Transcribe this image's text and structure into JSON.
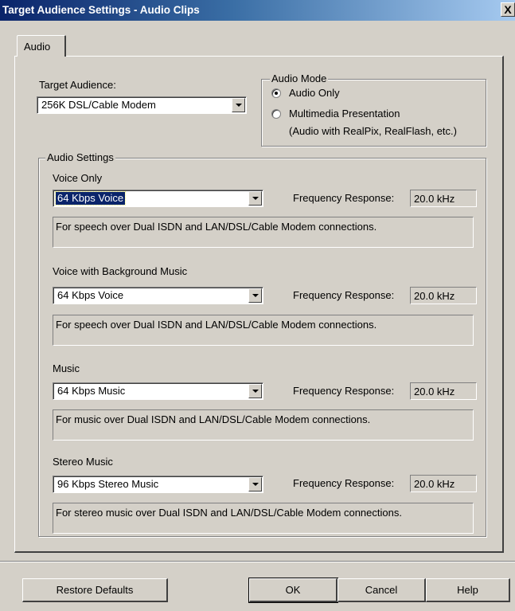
{
  "window": {
    "title": "Target Audience Settings - Audio Clips",
    "close_glyph": "X"
  },
  "tabs": [
    {
      "label": "Audio",
      "active": true
    }
  ],
  "target_audience": {
    "label": "Target Audience:",
    "value": "256K DSL/Cable Modem"
  },
  "audio_mode": {
    "label": "Audio Mode",
    "options": [
      {
        "label": "Audio Only",
        "selected": true
      },
      {
        "label": "Multimedia Presentation",
        "sublabel": "(Audio with RealPix, RealFlash, etc.)",
        "selected": false
      }
    ]
  },
  "audio_settings": {
    "label": "Audio Settings",
    "sections": [
      {
        "label": "Voice Only",
        "value": "64 Kbps Voice",
        "freq_label": "Frequency Response:",
        "freq_value": "20.0 kHz",
        "description": "For speech over Dual ISDN and LAN/DSL/Cable Modem connections."
      },
      {
        "label": "Voice with Background Music",
        "value": "64 Kbps Voice",
        "freq_label": "Frequency Response:",
        "freq_value": "20.0 kHz",
        "description": "For speech over Dual ISDN and LAN/DSL/Cable Modem connections."
      },
      {
        "label": "Music",
        "value": "64 Kbps Music",
        "freq_label": "Frequency Response:",
        "freq_value": "20.0 kHz",
        "description": "For music over Dual ISDN and LAN/DSL/Cable Modem connections."
      },
      {
        "label": "Stereo Music",
        "value": "96 Kbps Stereo Music",
        "freq_label": "Frequency Response:",
        "freq_value": "20.0 kHz",
        "description": "For stereo music over Dual ISDN and LAN/DSL/Cable Modem connections."
      }
    ]
  },
  "buttons": {
    "restore": "Restore Defaults",
    "ok": "OK",
    "cancel": "Cancel",
    "help": "Help"
  },
  "colors": {
    "title_active": "#0a246a",
    "face": "#d4d0c8",
    "selection": "#0a246a"
  }
}
